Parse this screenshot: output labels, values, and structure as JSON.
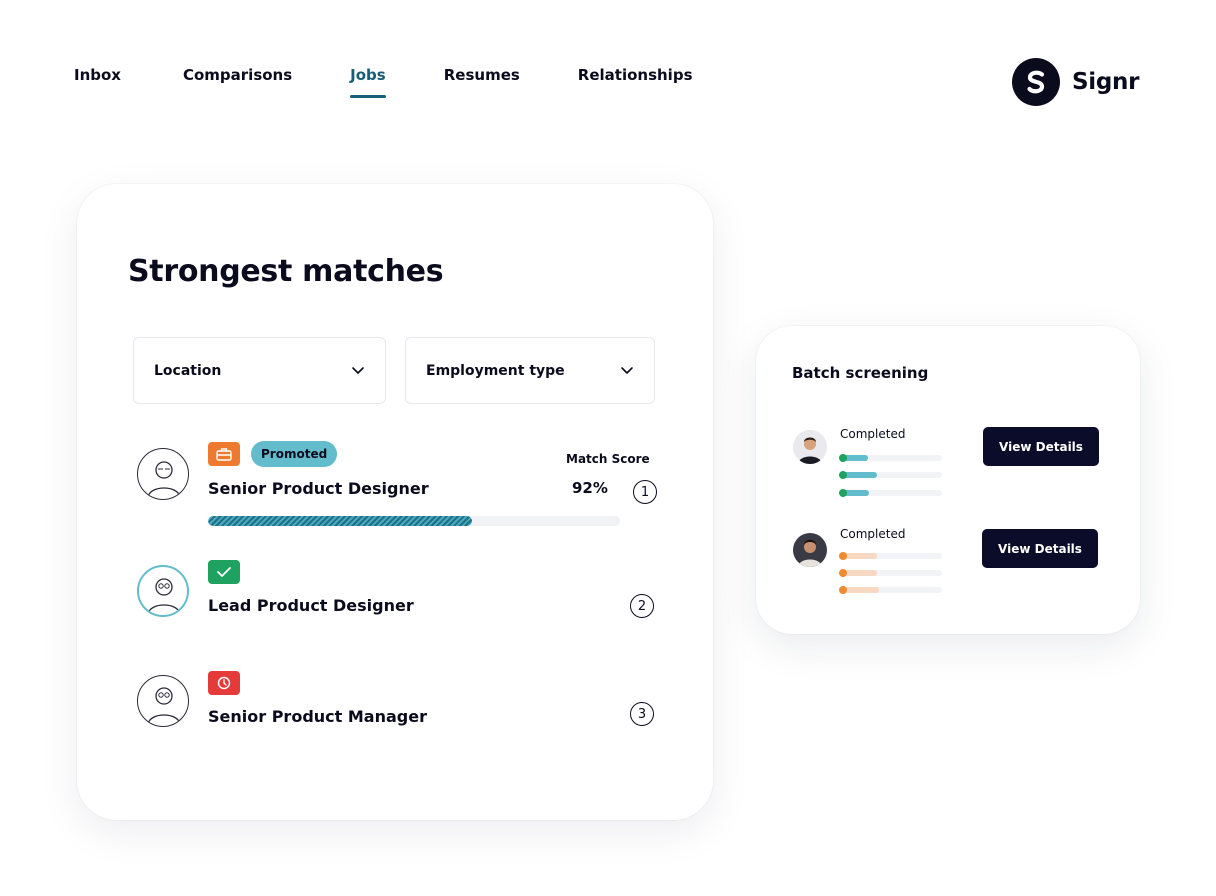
{
  "nav": {
    "items": [
      {
        "label": "Inbox",
        "active": false
      },
      {
        "label": "Comparisons",
        "active": false
      },
      {
        "label": "Jobs",
        "active": true
      },
      {
        "label": "Resumes",
        "active": false
      },
      {
        "label": "Relationships",
        "active": false
      }
    ]
  },
  "brand": {
    "name": "Signr",
    "logo_icon": "signr-s-logo"
  },
  "matches": {
    "title": "Strongest matches",
    "filters": [
      {
        "label": "Location",
        "icon": "chevron-down-icon"
      },
      {
        "label": "Employment type",
        "icon": "chevron-down-icon"
      }
    ],
    "match_score_label": "Match Score",
    "jobs": [
      {
        "title": "Senior Product Designer",
        "badge_icon": "briefcase-icon",
        "badge_color": "#ee7a30",
        "pill": "Promoted",
        "score": "92%",
        "score_fraction": 0.64,
        "rank": "1"
      },
      {
        "title": "Lead Product Designer",
        "badge_icon": "checkmark-icon",
        "badge_color": "#1fa160",
        "rank": "2"
      },
      {
        "title": "Senior Product Manager",
        "badge_icon": "clock-icon",
        "badge_color": "#e53a3a",
        "rank": "3"
      }
    ]
  },
  "batch": {
    "title": "Batch screening",
    "people": [
      {
        "status": "Completed",
        "button": "View Details",
        "dot_color": "#1fa160",
        "bar_color": "#62bccb",
        "bars": [
          0.27,
          0.36,
          0.28
        ]
      },
      {
        "status": "Completed",
        "button": "View Details",
        "dot_color": "#ee8a30",
        "bar_color": "#f7d8c2",
        "bars": [
          0.36,
          0.36,
          0.38
        ]
      }
    ]
  },
  "colors": {
    "accent": "#155e75",
    "dark": "#0b0b1e",
    "button": "#0b0b2a"
  }
}
